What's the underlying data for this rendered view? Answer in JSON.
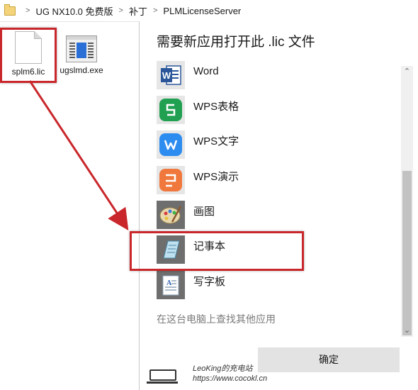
{
  "breadcrumb": {
    "items": [
      "UG NX10.0 免费版",
      "补丁",
      "PLMLicenseServer"
    ],
    "separator": ">"
  },
  "files": [
    {
      "name": "splm6.lic",
      "icon": "document-icon"
    },
    {
      "name": "ugslmd.exe",
      "icon": "exe-icon"
    }
  ],
  "dialog": {
    "title": "需要新应用打开此 .lic 文件",
    "apps": [
      {
        "label": "Word",
        "icon": "word-icon"
      },
      {
        "label": "WPS表格",
        "icon": "wps-spreadsheet-icon"
      },
      {
        "label": "WPS文字",
        "icon": "wps-writer-icon"
      },
      {
        "label": "WPS演示",
        "icon": "wps-presentation-icon"
      },
      {
        "label": "画图",
        "icon": "paint-icon"
      },
      {
        "label": "记事本",
        "icon": "notepad-icon"
      },
      {
        "label": "写字板",
        "icon": "wordpad-icon"
      }
    ],
    "more_link": "在这台电脑上查找其他应用",
    "ok_label": "确定"
  },
  "watermark": {
    "line1": "LeoKing的充电站",
    "line2": "https://www.cocokl.cn"
  },
  "colors": {
    "highlight_box": "#c9272b",
    "word_blue": "#2b579a",
    "wps_green": "#21a051",
    "wps_blue": "#2d8cf0",
    "wps_orange": "#f0783c"
  }
}
